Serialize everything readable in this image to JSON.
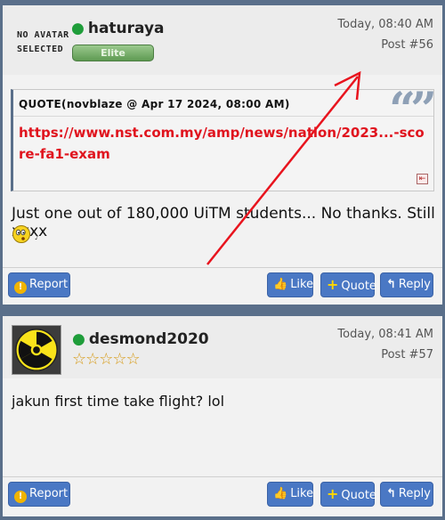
{
  "posts": [
    {
      "author": "haturaya",
      "avatar_text_line1": "NO AVATAR",
      "avatar_text_line2": "SELECTED",
      "rank": "Elite",
      "datetime": "Today, 08:40 AM",
      "post_number": "Post #56",
      "quote": {
        "label": "QUOTE(novblaze @ Apr 17 2024, 08:00 AM)",
        "link_text": "https://www.nst.com.my/amp/news/nation/2023...-score-fa1-exam"
      },
      "body": "Just one out of 180,000 UiTM students... No thanks. Still xxxx",
      "emoji_name": "whistling-emoji-icon"
    },
    {
      "author": "desmond2020",
      "stars": "☆☆☆☆☆",
      "avatar_icon": "radiation-icon",
      "datetime": "Today, 08:41 AM",
      "post_number": "Post #57",
      "body": "jakun first time take flight? lol"
    }
  ],
  "buttons": {
    "report": "Report",
    "like": "Like",
    "quote": "Quote",
    "reply": "Reply"
  },
  "colors": {
    "frame": "#5a6f8a",
    "button": "#4a78c4",
    "online": "#1f9d3a",
    "quote_link": "#e0141e",
    "annotation_arrow": "#e8141e"
  },
  "quote_mark_glyph": "“”"
}
